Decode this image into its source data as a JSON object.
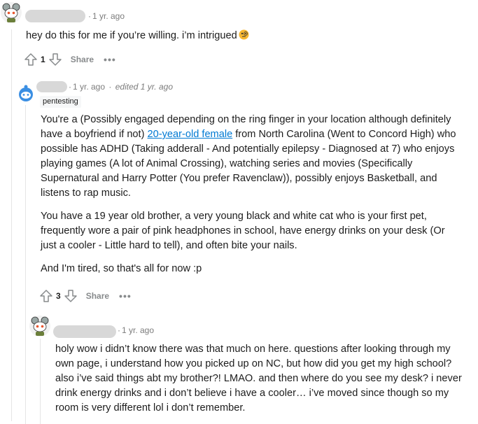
{
  "comments": [
    {
      "age": "1 yr. ago",
      "text": "hey do this for me if you’re willing. i’m intrigued",
      "emoji": "face-with-monocle-icon",
      "votes": "1",
      "share_label": "Share",
      "more_label": "•••"
    },
    {
      "age": "1 yr. ago",
      "edited": "edited 1 yr. ago",
      "flair": "pentesting",
      "para1_a": "You're a (Possibly engaged depending on the ring finger in your location although definitely have a boyfriend if not) ",
      "para1_link": "20-year-old female",
      "para1_b": " from North Carolina (Went to Concord High) who possible has ADHD (Taking adderall - And potentially epilepsy - Diagnosed at 7) who enjoys playing games (A lot of Animal Crossing), watching series and movies (Specifically Supernatural and Harry Potter (You prefer Ravenclaw)), possibly enjoys Basketball, and listens to rap music.",
      "para2": "You have a 19 year old brother, a very young black and white cat who is your first pet, frequently wore a pair of pink headphones in school, have energy drinks on your desk (Or just a cooler - Little hard to tell), and often bite your nails.",
      "para3": "And I'm tired, so that's all for now :p",
      "votes": "3",
      "share_label": "Share",
      "more_label": "•••"
    },
    {
      "age": "1 yr. ago",
      "text": "holy wow i didn’t know there was that much on here. questions after looking through my own page, i understand how you picked up on NC, but how did you get my high school? also i’ve said things abt my brother?! LMAO. and then where do you see my desk? i never drink energy drinks and i don’t believe i have a cooler… i’ve moved since though so my room is very different lol i don’t remember."
    }
  ],
  "colors": {
    "link": "#0079d3",
    "meta": "#7c7c7c",
    "action": "#878a8c",
    "thread_line": "#e5e5e5"
  }
}
